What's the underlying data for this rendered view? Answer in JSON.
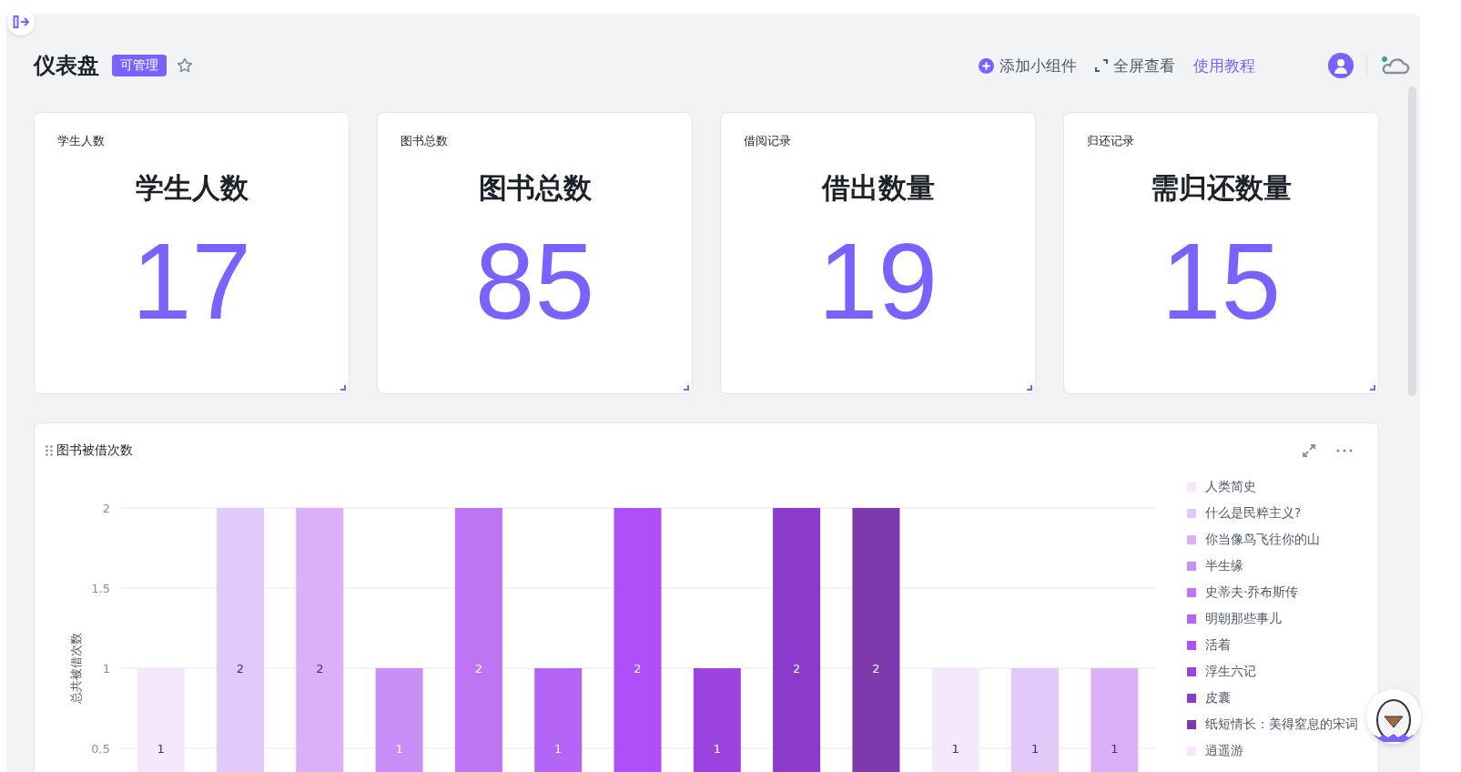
{
  "header": {
    "title": "仪表盘",
    "badge": "可管理",
    "starred": false,
    "actions": [
      {
        "kind": "add",
        "label": "添加小组件"
      },
      {
        "kind": "fullscreen",
        "label": "全屏查看"
      },
      {
        "kind": "link",
        "label": "使用教程"
      }
    ]
  },
  "stat_cards": [
    {
      "caption": "学生人数",
      "heading": "学生人数",
      "value": "17"
    },
    {
      "caption": "图书总数",
      "heading": "图书总数",
      "value": "85"
    },
    {
      "caption": "借阅记录",
      "heading": "借出数量",
      "value": "19"
    },
    {
      "caption": "归还记录",
      "heading": "需归还数量",
      "value": "15"
    }
  ],
  "chart_card": {
    "title": "图书被借次数",
    "chart_data": {
      "type": "bar",
      "ylabel": "总共被借次数",
      "yticks": [
        0.5,
        1,
        1.5,
        2
      ],
      "ylim": [
        0,
        2
      ],
      "grid": true,
      "data_labels": true,
      "values": [
        1,
        2,
        2,
        1,
        2,
        1,
        2,
        1,
        2,
        2,
        1,
        1,
        1
      ],
      "colors": [
        "#f5e8fd",
        "#e3c8fa",
        "#dab0f7",
        "#c88ef5",
        "#bd75f4",
        "#b265f5",
        "#ae4ff9",
        "#9b43df",
        "#8b3acc",
        "#7c3aad",
        "#f5e8fd",
        "#e3c8fa",
        "#dab0f7"
      ]
    },
    "legend": [
      {
        "label": "人类简史",
        "color": "#f5e8fd"
      },
      {
        "label": "什么是民粹主义?",
        "color": "#e3c8fa"
      },
      {
        "label": "你当像鸟飞往你的山",
        "color": "#dab0f7"
      },
      {
        "label": "半生缘",
        "color": "#c88ef5"
      },
      {
        "label": "史蒂夫·乔布斯传",
        "color": "#bd75f4"
      },
      {
        "label": "明朝那些事儿",
        "color": "#b265f5"
      },
      {
        "label": "活着",
        "color": "#ae4ff9"
      },
      {
        "label": "浮生六记",
        "color": "#9b43df"
      },
      {
        "label": "皮囊",
        "color": "#8b3acc"
      },
      {
        "label": "纸短情长：美得窒息的宋词",
        "color": "#7c3aad"
      },
      {
        "label": "逍遥游",
        "color": "#f5e8fd"
      }
    ]
  }
}
